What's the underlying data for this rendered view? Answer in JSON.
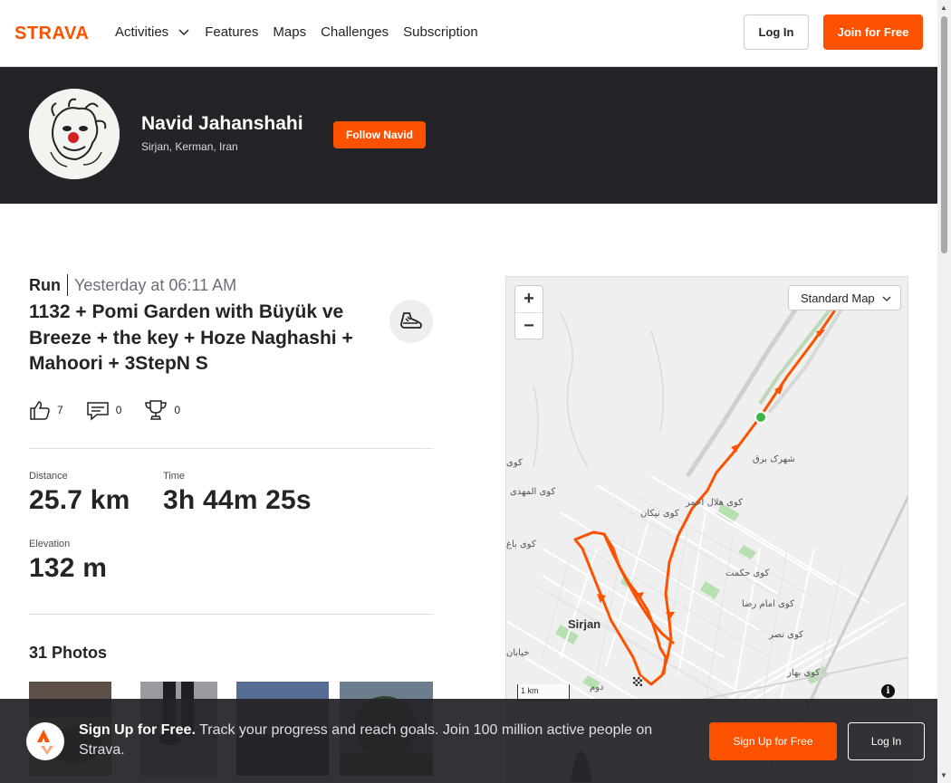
{
  "brand": {
    "logo_text": "STRAVA",
    "accent": "#fc5200"
  },
  "nav": {
    "items": [
      {
        "label": "Activities",
        "has_dropdown": true
      },
      {
        "label": "Features"
      },
      {
        "label": "Maps"
      },
      {
        "label": "Challenges"
      },
      {
        "label": "Subscription"
      }
    ],
    "login_label": "Log In",
    "join_label": "Join for Free"
  },
  "athlete": {
    "name": "Navid Jahanshahi",
    "location": "Sirjan, Kerman, Iran",
    "follow_label": "Follow Navid"
  },
  "activity": {
    "type": "Run",
    "time": "Yesterday at 06:11 AM",
    "title": "1132 + Pomi Garden with Büyük ve Breeze + the key + Hoze Naghashi + Mahoori + 3StepN S",
    "gear_icon": "running-shoe-icon",
    "kudos": "7",
    "comments": "0",
    "achievements": "0",
    "stats": {
      "distance_label": "Distance",
      "distance_value": "25.7 km",
      "time_label": "Time",
      "time_value": "3h 44m 25s",
      "elevation_label": "Elevation",
      "elevation_value": "132 m"
    },
    "photos_title": "31 Photos"
  },
  "map": {
    "type_label": "Standard Map",
    "zoom_in": "+",
    "zoom_out": "−",
    "scale_label": "1 km",
    "info": "i",
    "city": "Sirjan",
    "labels": [
      "شهرک برق",
      "کوی هلال احمر",
      "کوی نیکان",
      "کوی المهدی",
      "کوی باغ",
      "کوی حکمت",
      "کوی امام رضا",
      "کوی نصر",
      "کوی بهار",
      "خیابان",
      "دوم",
      "کوی"
    ]
  },
  "signup": {
    "bold": "Sign Up for Free.",
    "text": " Track your progress and reach goals. Join 100 million active people on Strava.",
    "signup_label": "Sign Up for Free",
    "login_label": "Log In"
  }
}
